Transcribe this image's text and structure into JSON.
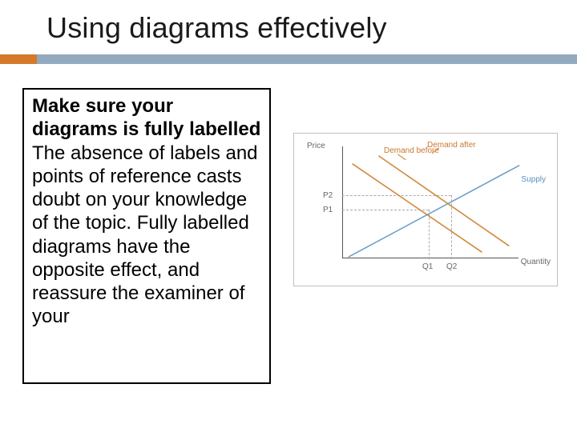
{
  "title": "Using diagrams effectively",
  "text": {
    "heading": "Make sure your diagrams is fully labelled",
    "body": "The absence of labels and points of reference casts doubt on your knowledge of the topic. Fully labelled diagrams have the opposite effect, and reassure the examiner of your"
  },
  "chart_data": {
    "type": "line",
    "title": "",
    "xlabel": "Quantity",
    "ylabel": "Price",
    "series": [
      {
        "name": "Demand before",
        "color": "#d08a3a",
        "points": [
          [
            0.05,
            0.78
          ],
          [
            0.8,
            0.12
          ]
        ]
      },
      {
        "name": "Demand after",
        "color": "#d08a3a",
        "points": [
          [
            0.18,
            0.86
          ],
          [
            0.92,
            0.2
          ]
        ]
      },
      {
        "name": "Supply",
        "color": "#6e9fc9",
        "points": [
          [
            0.05,
            0.18
          ],
          [
            0.92,
            0.82
          ]
        ]
      }
    ],
    "y_ticks": [
      "P1",
      "P2"
    ],
    "x_ticks": [
      "Q1",
      "Q2"
    ],
    "intersections": [
      {
        "x_tick": "Q1",
        "y_tick": "P1"
      },
      {
        "x_tick": "Q2",
        "y_tick": "P2"
      }
    ]
  }
}
